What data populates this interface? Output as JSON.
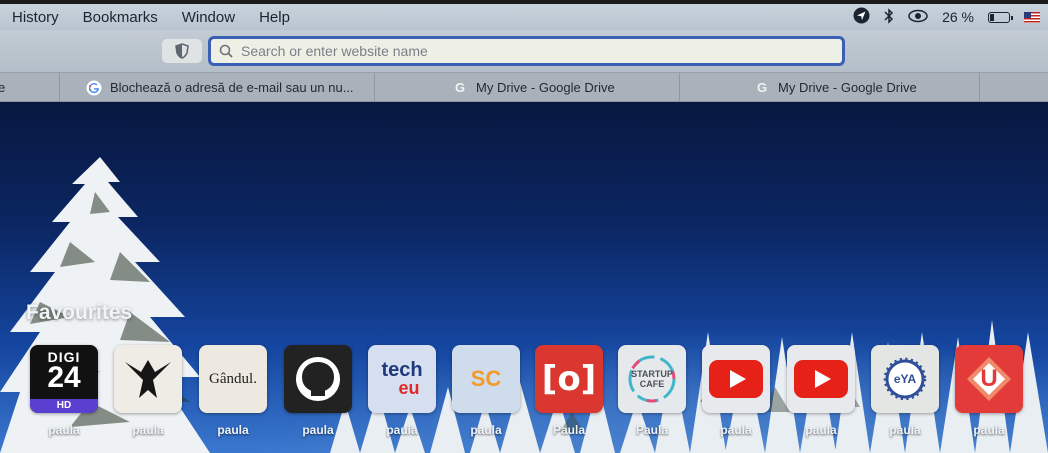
{
  "menubar": {
    "items": [
      "History",
      "Bookmarks",
      "Window",
      "Help"
    ],
    "battery_text": "26 %",
    "battery_level": 0.26,
    "status_icons": [
      "location-arrow-icon",
      "bluetooth-icon",
      "screen-time-icon",
      "battery-icon",
      "us-flag-icon"
    ]
  },
  "toolbar": {
    "search_placeholder": "Search or enter website name"
  },
  "tabs": [
    {
      "favicon": "G",
      "title": "Blochează o adresă de e-mail sau un nu..."
    },
    {
      "favicon": "G",
      "title": "My Drive - Google Drive"
    },
    {
      "favicon": "G",
      "title": "My Drive - Google Drive"
    }
  ],
  "favourites": {
    "heading": "Favourites",
    "items": [
      {
        "label": "paula",
        "icon": "digi24-icon",
        "line1": "DIGI",
        "line2": "24",
        "line3": "HD"
      },
      {
        "label": "paula",
        "icon": "mask-logo-icon"
      },
      {
        "label": "paula",
        "icon": "gandul-icon",
        "text": "Gândul."
      },
      {
        "label": "paula",
        "icon": "github-icon"
      },
      {
        "label": "paula",
        "icon": "techeu-icon",
        "line1": "tech",
        "line2": "eu"
      },
      {
        "label": "paula",
        "icon": "sc-icon",
        "text": "SC"
      },
      {
        "label": "Paula",
        "icon": "bracket-o-icon",
        "text": "[o]"
      },
      {
        "label": "Paula",
        "icon": "startup-cafe-icon",
        "line1": "STARTUP",
        "line2": "CAFE"
      },
      {
        "label": "paula",
        "icon": "youtube-icon"
      },
      {
        "label": "paula",
        "icon": "youtube-icon"
      },
      {
        "label": "paula",
        "icon": "eya-icon",
        "text": "eYA"
      },
      {
        "label": "paula",
        "icon": "u-logo-icon",
        "text": "U"
      }
    ]
  },
  "colors": {
    "address_border": "#3a5fb5",
    "youtube_red": "#e62117",
    "sc_orange": "#f39a2a"
  }
}
